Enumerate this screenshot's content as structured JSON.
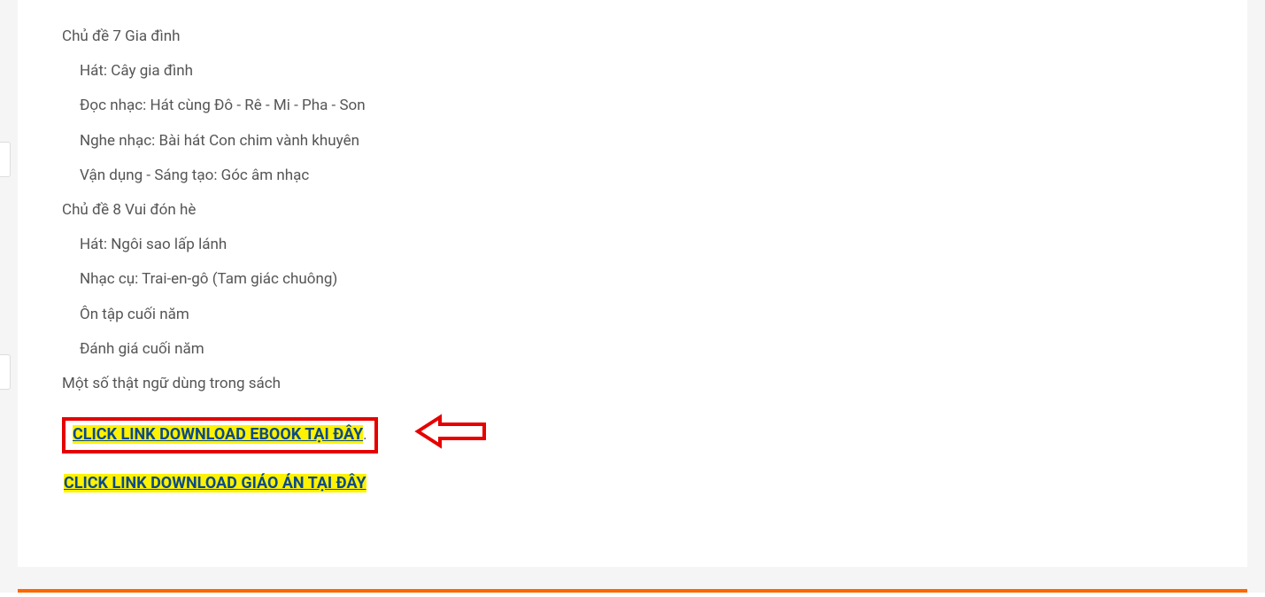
{
  "topic7": {
    "title": "Chủ đề 7 Gia đình",
    "items": [
      "Hát: Cây gia đình",
      "Đọc nhạc: Hát cùng Đô - Rê - Mi - Pha - Son",
      "Nghe nhạc: Bài hát Con chim vành khuyên",
      "Vận dụng - Sáng tạo: Góc âm nhạc"
    ]
  },
  "topic8": {
    "title": "Chủ đề 8 Vui đón hè",
    "items": [
      "Hát: Ngôi sao lấp lánh",
      "Nhạc cụ: Trai-en-gô (Tam giác chuông)",
      "Ôn tập cuối năm",
      "Đánh giá cuối năm"
    ]
  },
  "glossary": "Một số thật ngữ dùng trong sách",
  "download1": {
    "text": "CLICK LINK DOWNLOAD EBOOK TẠI ĐÂY",
    "period": "."
  },
  "download2": {
    "text": "CLICK LINK DOWNLOAD GIÁO ÁN TẠI ĐÂY"
  }
}
